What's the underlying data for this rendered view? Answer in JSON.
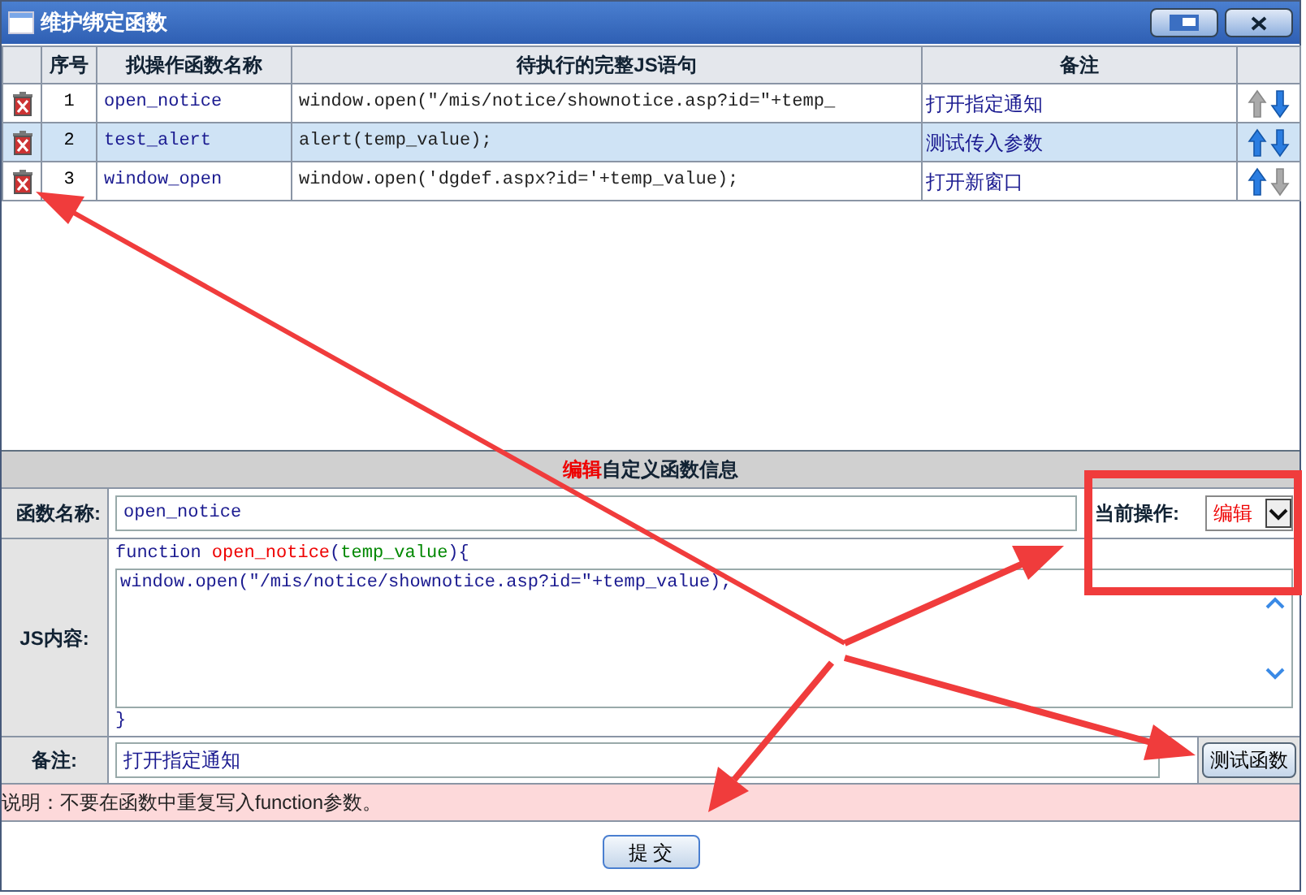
{
  "window": {
    "title": "维护绑定函数"
  },
  "table": {
    "columns": [
      "序号",
      "拟操作函数名称",
      "待执行的完整JS语句",
      "备注"
    ],
    "rows": [
      {
        "index": "1",
        "name": "open_notice",
        "statement": "window.open(\"/mis/notice/shownotice.asp?id=\"+temp_",
        "remark": "打开指定通知",
        "selected": false,
        "up_enabled": false,
        "down_enabled": true
      },
      {
        "index": "2",
        "name": "test_alert",
        "statement": "alert(temp_value);",
        "remark": "测试传入参数",
        "selected": true,
        "up_enabled": true,
        "down_enabled": true
      },
      {
        "index": "3",
        "name": "window_open",
        "statement": "window.open('dgdef.aspx?id='+temp_value);",
        "remark": "打开新窗口",
        "selected": false,
        "up_enabled": true,
        "down_enabled": false
      }
    ]
  },
  "editor": {
    "mode": "编辑",
    "title": "自定义函数信息",
    "name_label": "函数名称:",
    "name_value": "open_notice",
    "operation_label": "当前操作:",
    "operation_value": "编辑",
    "js_label": "JS内容:",
    "signature": {
      "keyword": "function",
      "name": "open_notice",
      "open": "(",
      "param": "temp_value",
      "close": "){"
    },
    "body": "window.open(\"/mis/notice/shownotice.asp?id=\"+temp_value);",
    "closing": "}",
    "remark_label": "备注:",
    "remark_value": "打开指定通知",
    "test_button": "测试函数",
    "note": "说明：不要在函数中重复写入function参数。",
    "submit": "提 交"
  }
}
